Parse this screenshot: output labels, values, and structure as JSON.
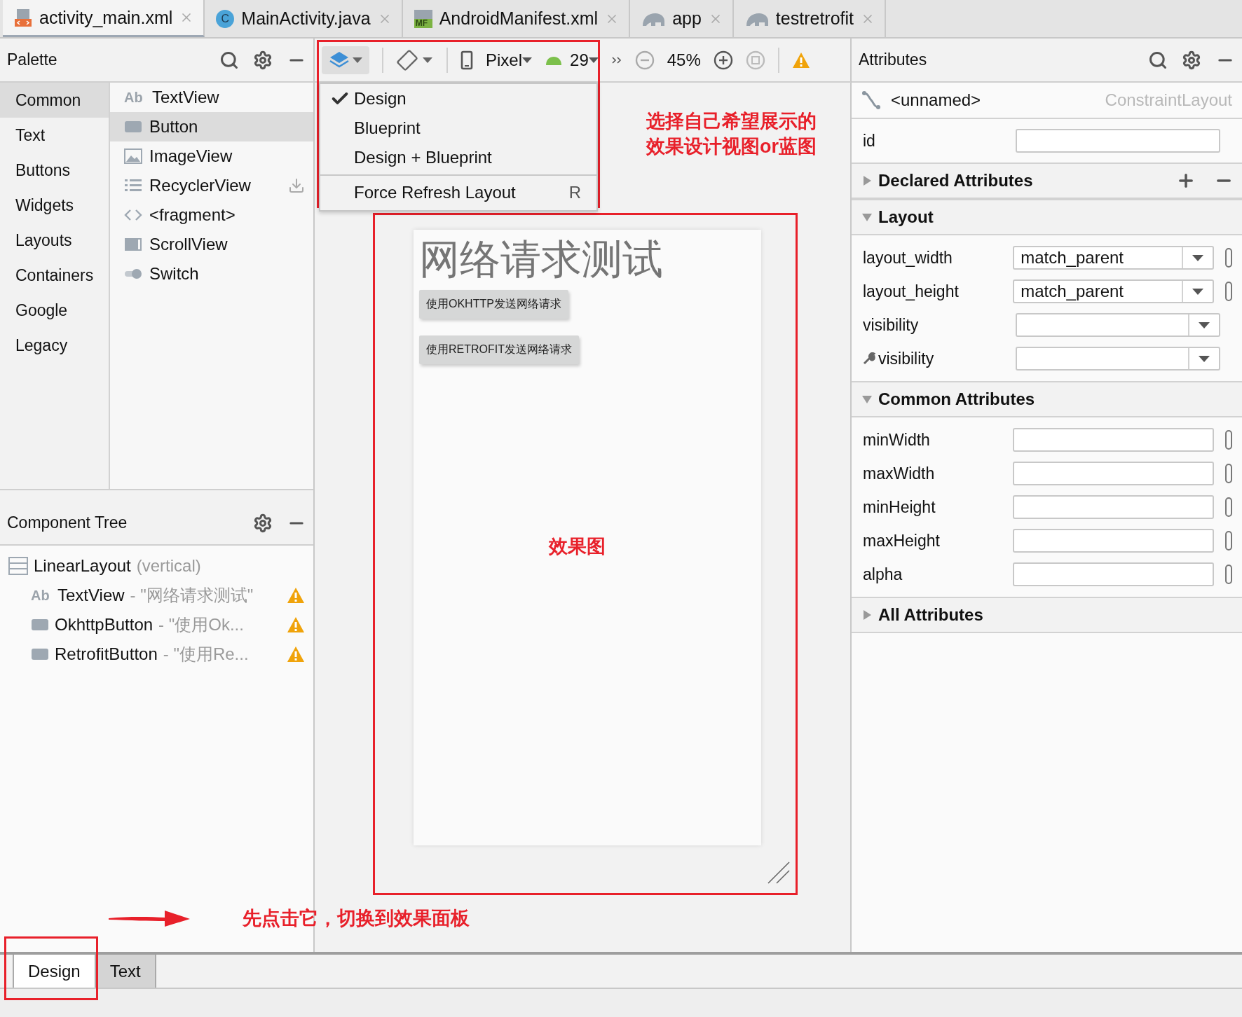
{
  "editor_tabs": [
    {
      "label": "activity_main.xml",
      "kind": "layout",
      "selected": true
    },
    {
      "label": "MainActivity.java",
      "kind": "class",
      "badge": "C",
      "selected": false
    },
    {
      "label": "AndroidManifest.xml",
      "kind": "manifest",
      "badge": "MF",
      "selected": false
    },
    {
      "label": "app",
      "kind": "module",
      "selected": false
    },
    {
      "label": "testretrofit",
      "kind": "module",
      "selected": false
    }
  ],
  "palette": {
    "title": "Palette",
    "categories": [
      {
        "label": "Common",
        "selected": true
      },
      {
        "label": "Text",
        "selected": false
      },
      {
        "label": "Buttons",
        "selected": false
      },
      {
        "label": "Widgets",
        "selected": false
      },
      {
        "label": "Layouts",
        "selected": false
      },
      {
        "label": "Containers",
        "selected": false
      },
      {
        "label": "Google",
        "selected": false
      },
      {
        "label": "Legacy",
        "selected": false
      }
    ],
    "items": [
      {
        "label": "TextView",
        "kind": "text",
        "badge": "Ab",
        "selected": false,
        "download": false
      },
      {
        "label": "Button",
        "kind": "button",
        "selected": true,
        "download": false
      },
      {
        "label": "ImageView",
        "kind": "image",
        "selected": false,
        "download": false
      },
      {
        "label": "RecyclerView",
        "kind": "list",
        "selected": false,
        "download": true
      },
      {
        "label": "<fragment>",
        "kind": "fragment",
        "selected": false,
        "download": false
      },
      {
        "label": "ScrollView",
        "kind": "scroll",
        "selected": false,
        "download": false
      },
      {
        "label": "Switch",
        "kind": "switch",
        "selected": false,
        "download": false
      }
    ]
  },
  "component_tree": {
    "title": "Component Tree",
    "root": {
      "label": "LinearLayout",
      "detail": "(vertical)",
      "kind": "layout",
      "children": [
        {
          "label": "TextView",
          "detail": "- \"网络请求测试\"",
          "kind": "text",
          "badge": "Ab",
          "warning": true
        },
        {
          "label": "OkhttpButton",
          "detail": "- \"使用Ok...",
          "kind": "button",
          "warning": true
        },
        {
          "label": "RetrofitButton",
          "detail": "- \"使用Re...",
          "kind": "button",
          "warning": true
        }
      ]
    }
  },
  "toolbar": {
    "device": "Pixel",
    "api_level": "29",
    "zoom": "45%"
  },
  "view_menu": {
    "items": [
      {
        "label": "Design",
        "kind": "option",
        "checked": true
      },
      {
        "label": "Blueprint",
        "kind": "option",
        "checked": false
      },
      {
        "label": "Design + Blueprint",
        "kind": "option",
        "checked": false
      },
      {
        "label": "Force Refresh Layout",
        "kind": "action",
        "shortcut": "R"
      }
    ]
  },
  "preview": {
    "title": "网络请求测试",
    "buttons": [
      "使用OKHTTP发送网络请求",
      "使用RETROFIT发送网络请求"
    ]
  },
  "attributes": {
    "title": "Attributes",
    "component": "<unnamed>",
    "component_type": "ConstraintLayout",
    "id_label": "id",
    "sections": [
      {
        "title": "Declared Attributes",
        "expanded": false,
        "actions": true
      },
      {
        "title": "Layout",
        "expanded": true,
        "actions": false,
        "rows": [
          {
            "label": "layout_width",
            "kind": "dropdown",
            "value": "match_parent",
            "toggle": true,
            "tool": false
          },
          {
            "label": "layout_height",
            "kind": "dropdown",
            "value": "match_parent",
            "toggle": true,
            "tool": false
          },
          {
            "label": "visibility",
            "kind": "dropdown",
            "toggle": false,
            "tool": false
          },
          {
            "label": "visibility",
            "kind": "dropdown",
            "toggle": false,
            "tool": true
          }
        ]
      },
      {
        "title": "Common Attributes",
        "expanded": true,
        "actions": false,
        "rows": [
          {
            "label": "minWidth",
            "kind": "text",
            "toggle": true,
            "tool": false
          },
          {
            "label": "maxWidth",
            "kind": "text",
            "toggle": true,
            "tool": false
          },
          {
            "label": "minHeight",
            "kind": "text",
            "toggle": true,
            "tool": false
          },
          {
            "label": "maxHeight",
            "kind": "text",
            "toggle": true,
            "tool": false
          },
          {
            "label": "alpha",
            "kind": "text",
            "toggle": true,
            "tool": false
          }
        ]
      },
      {
        "title": "All Attributes",
        "expanded": false,
        "actions": false
      }
    ]
  },
  "bottom_tabs": [
    {
      "label": "Design",
      "selected": true
    },
    {
      "label": "Text",
      "selected": false
    }
  ],
  "annotations": {
    "menu_note": [
      "选择自己希望展示的",
      "效果设计视图or蓝图"
    ],
    "preview_note": "效果图",
    "tab_note": "先点击它，切换到效果面板"
  }
}
